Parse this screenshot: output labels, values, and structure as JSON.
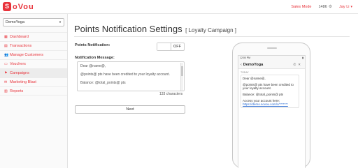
{
  "brand": {
    "logo_mark": "S",
    "name": "oVou"
  },
  "topbar": {
    "sales_mode": "Sales Mode",
    "points": "1486",
    "user": "Jay Li"
  },
  "sidebar": {
    "store": "DemoYoga",
    "items": [
      {
        "label": "Dashboard",
        "icon": "dashboard-icon",
        "glyph": "▦"
      },
      {
        "label": "Transactions",
        "icon": "transactions-icon",
        "glyph": "▤"
      },
      {
        "label": "Manage Customers",
        "icon": "customers-icon",
        "glyph": "👥"
      },
      {
        "label": "Vouchers",
        "icon": "voucher-icon",
        "glyph": "▭"
      },
      {
        "label": "Campaigns",
        "icon": "campaign-flag-icon",
        "glyph": "⚑"
      },
      {
        "label": "Marketing Blast",
        "icon": "blast-icon",
        "glyph": "✉"
      },
      {
        "label": "Reports",
        "icon": "report-icon",
        "glyph": "▥"
      }
    ]
  },
  "page": {
    "title": "Points Notification Settings",
    "subtitle": "[ Loyalty Campaign ]",
    "points_notification_label": "Points Notification:",
    "toggle_state": "OFF",
    "message_label": "Notification Message:",
    "message_lines": [
      "Dear @name@,",
      "@points@ pts have been credited to your loyalty account.",
      "Balance: @total_points@ pts"
    ],
    "char_count": "133 characters",
    "next_button": "Next"
  },
  "phone_preview": {
    "time": "12:00 PM",
    "chat_title": "DemoYoga",
    "today": "TODAY",
    "bubble": [
      "Dear @name@,",
      "@points@ pts have been credited to your loyalty account.",
      "Balance: @total_points@ pts",
      "Access your account here:"
    ],
    "link": "https://demo.sovou.com/c/*******"
  },
  "colors": {
    "accent": "#e8333b"
  }
}
